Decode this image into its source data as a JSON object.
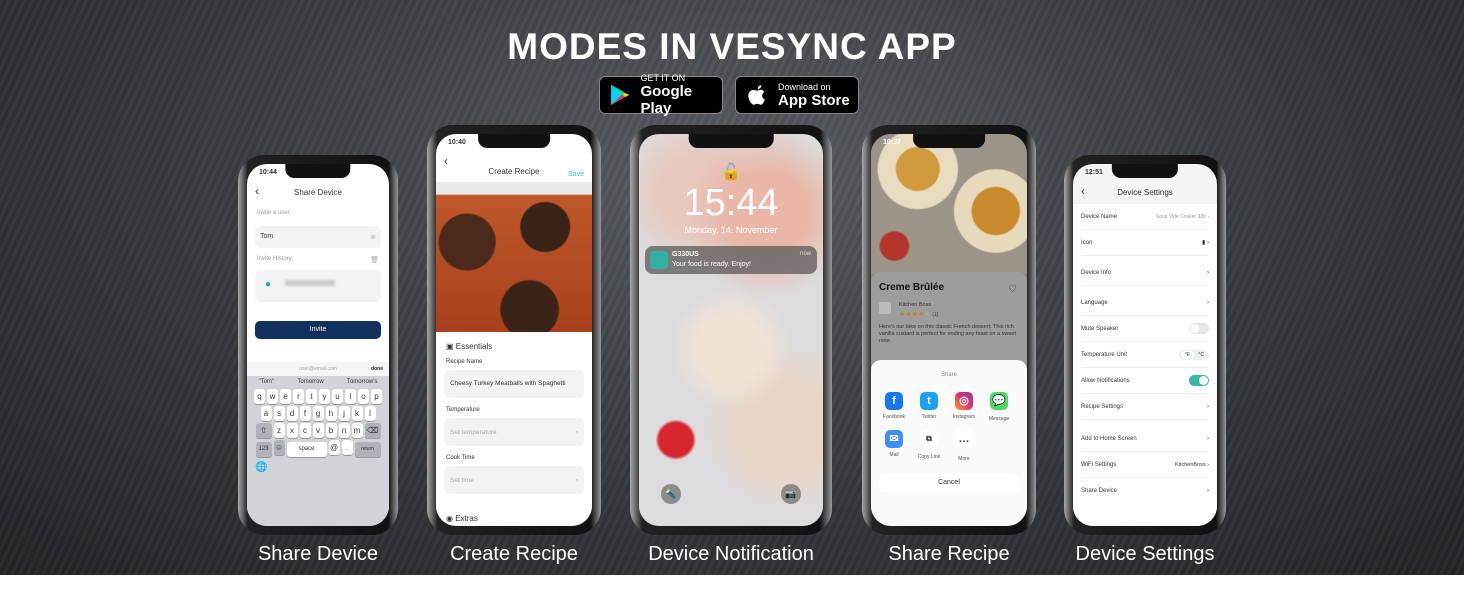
{
  "title": "MODES IN VESYNC APP",
  "badges": {
    "google": {
      "small": "GET IT ON",
      "large": "Google Play"
    },
    "apple": {
      "small": "Download on",
      "large": "App Store"
    }
  },
  "captions": [
    "Share Device",
    "Create Recipe",
    "Device Notification",
    "Share Recipe",
    "Device Settings"
  ],
  "share_device": {
    "time": "10:44",
    "title": "Share Device",
    "invite_label": "Invite a user:",
    "invite_value": "Tom",
    "history_label": "Invite History:",
    "invite_button": "Invite",
    "email_placeholder": "user@email.com",
    "done": "done",
    "suggestions": [
      "\"Tom\"",
      "Tomorrow",
      "Tomorrow's"
    ],
    "keys_row1": [
      "q",
      "w",
      "e",
      "r",
      "t",
      "y",
      "u",
      "i",
      "o",
      "p"
    ],
    "keys_row2": [
      "a",
      "s",
      "d",
      "f",
      "g",
      "h",
      "j",
      "k",
      "l"
    ],
    "keys_row3": [
      "z",
      "x",
      "c",
      "v",
      "b",
      "n",
      "m"
    ],
    "key_123": "123",
    "key_space": "space",
    "key_at": "@",
    "key_dot": ".",
    "key_return": "return",
    "accent": "#12305e"
  },
  "create_recipe": {
    "time": "10:40",
    "title": "Create Recipe",
    "save": "Save",
    "essentials": "Essentials",
    "recipe_name_label": "Recipe Name",
    "recipe_name_value": "Cheesy Turkey Meatballs with Spaghetti",
    "temperature_label": "Temperature",
    "temperature_placeholder": "Set temperature",
    "cook_time_label": "Cook Time",
    "cook_time_placeholder": "Set time",
    "extras": "Extras"
  },
  "notification": {
    "clock": "15:44",
    "date": "Monday, 14. November",
    "app": "G330US",
    "message": "Your food is ready. Enjoy!",
    "when": "now"
  },
  "share_recipe": {
    "time": "10:37",
    "recipe_title": "Creme Brûlée",
    "author": "Kitchen Boss",
    "rating": 4,
    "rating_max": 5,
    "rating_count": "(1)",
    "description": "Here's our take on this classic French dessert. This rich vanilla custard is perfect for ending any feast on a sweet note.",
    "share_title": "Share",
    "targets": [
      "Facebook",
      "Twitter",
      "Instagram",
      "Message",
      "Mail",
      "Copy Link",
      "More"
    ],
    "cancel": "Cancel"
  },
  "device_settings": {
    "time": "12:51",
    "title": "Device Settings",
    "device_name_label": "Device Name",
    "device_name_value": "Sous Vide Cooker 330",
    "rows": [
      "Icon",
      "Device Info",
      "Language",
      "Mute Speaker",
      "Temperature Unit",
      "Allow Notifications",
      "Recipe Settings",
      "Add to Home Screen",
      "WiFi Settings",
      "Share Device"
    ],
    "unit_f": "°F",
    "unit_c": "°C",
    "wifi_value": "KitchenBoss",
    "mute_speaker_on": false,
    "allow_notifications_on": true,
    "toggle_color": "#3bb7a5"
  }
}
